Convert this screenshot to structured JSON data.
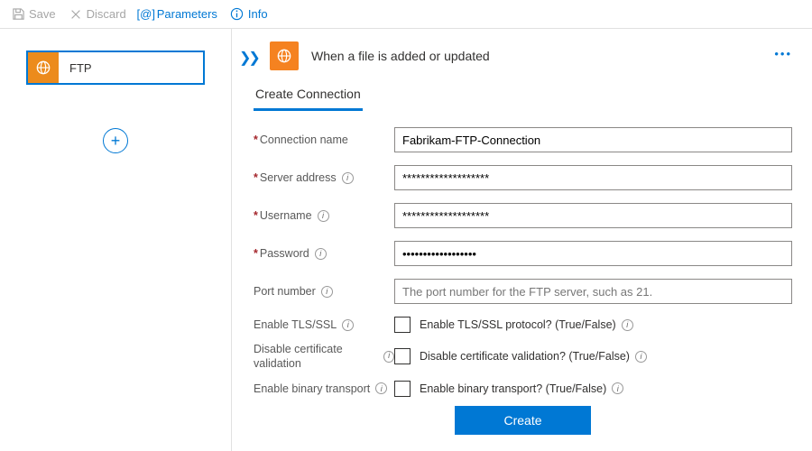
{
  "toolbar": {
    "save": "Save",
    "discard": "Discard",
    "parameters": "Parameters",
    "parameters_icon": "[@]",
    "info": "Info"
  },
  "sidebar": {
    "step_label": "FTP"
  },
  "header": {
    "title": "When a file is added or updated"
  },
  "tab": {
    "label": "Create Connection"
  },
  "form": {
    "connection_name": {
      "label": "Connection name",
      "value": "Fabrikam-FTP-Connection"
    },
    "server_address": {
      "label": "Server address",
      "value": "*******************"
    },
    "username": {
      "label": "Username",
      "value": "*******************"
    },
    "password": {
      "label": "Password",
      "value": "••••••••••••••••••"
    },
    "port_number": {
      "label": "Port number",
      "placeholder": "The port number for the FTP server, such as 21."
    },
    "tls": {
      "label": "Enable TLS/SSL",
      "checkbox_text": "Enable TLS/SSL protocol? (True/False)"
    },
    "cert": {
      "label": "Disable certificate validation",
      "checkbox_text": "Disable certificate validation? (True/False)"
    },
    "binary": {
      "label": "Enable binary transport",
      "checkbox_text": "Enable binary transport? (True/False)"
    }
  },
  "buttons": {
    "create": "Create"
  }
}
